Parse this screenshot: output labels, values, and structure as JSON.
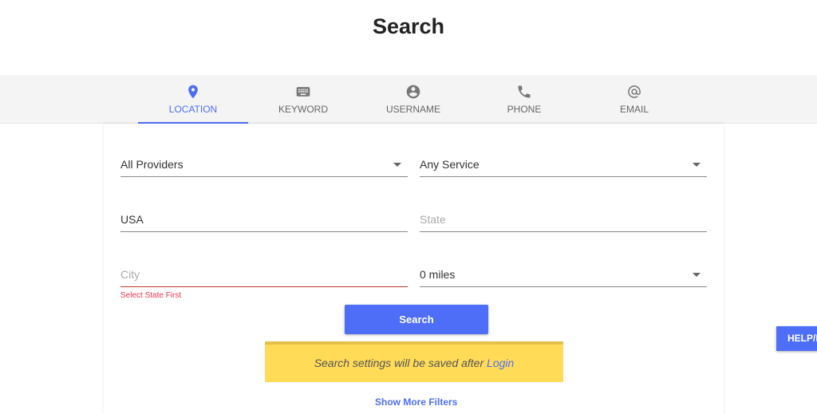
{
  "header": {
    "title": "Search"
  },
  "tabs": [
    {
      "label": "LOCATION",
      "icon": "map-pin-icon",
      "active": true
    },
    {
      "label": "KEYWORD",
      "icon": "keyboard-icon"
    },
    {
      "label": "USERNAME",
      "icon": "account-circle-icon"
    },
    {
      "label": "PHONE",
      "icon": "phone-icon"
    },
    {
      "label": "EMAIL",
      "icon": "at-icon"
    }
  ],
  "form": {
    "provider": "All Providers",
    "service": "Any Service",
    "country": "USA",
    "state_placeholder": "State",
    "city_placeholder": "City",
    "radius": "0 miles",
    "city_error": "Select State First",
    "search_label": "Search"
  },
  "notice": {
    "text": "Search settings will be saved after ",
    "link": "Login"
  },
  "more_filters": "Show More Filters",
  "help_label": "HELP/I",
  "colors": {
    "accent": "#4f6ef7",
    "notice": "#ffdb58",
    "error": "#e53950"
  }
}
